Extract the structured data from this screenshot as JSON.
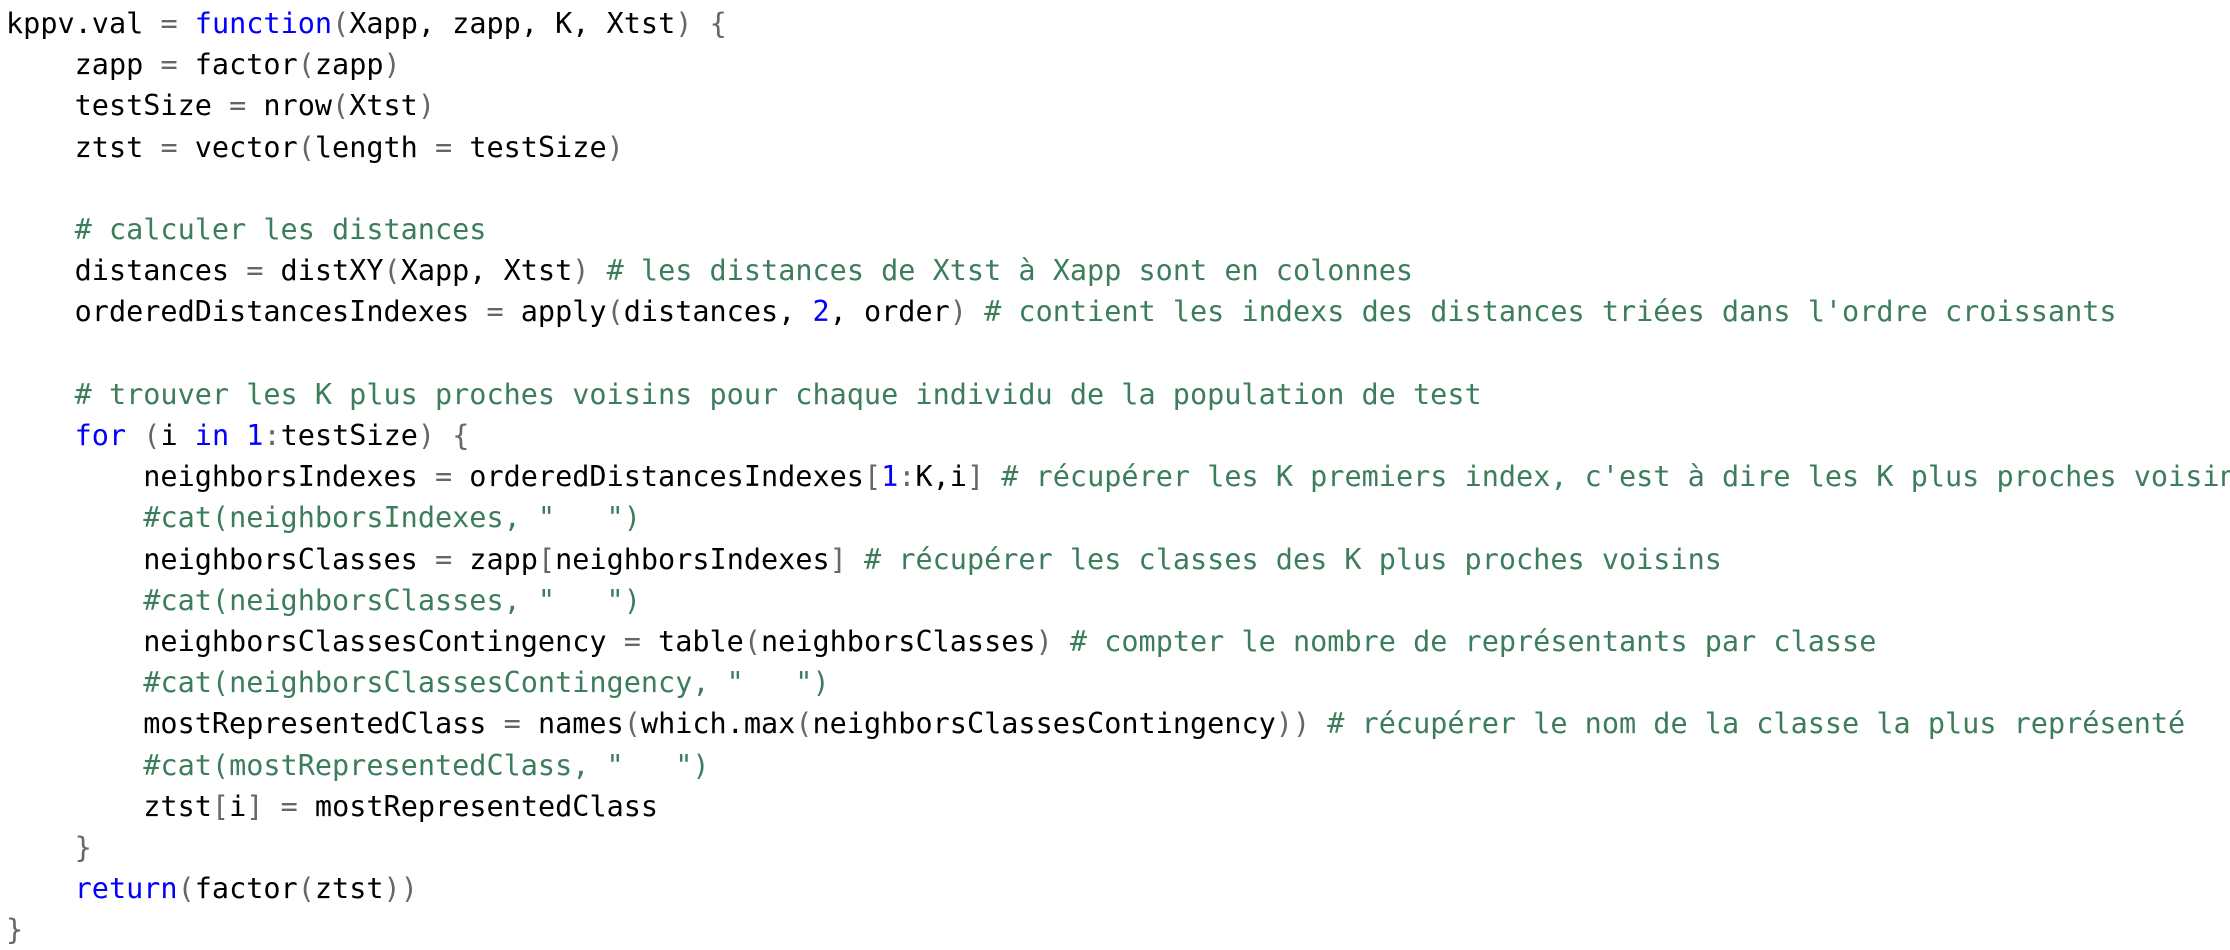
{
  "editor": {
    "language": "R",
    "colors": {
      "plain": "#000000",
      "keyword": "#0000ff",
      "number": "#0000ff",
      "comment": "#3c7d5b",
      "string": "#3c7d5b",
      "bracket": "#666666",
      "operator": "#666666",
      "background": "#ffffff"
    },
    "lines": [
      [
        [
          "plain",
          "kppv.val "
        ],
        [
          "operator",
          "="
        ],
        [
          "plain",
          " "
        ],
        [
          "keyword",
          "function"
        ],
        [
          "bracket",
          "("
        ],
        [
          "plain",
          "Xapp, zapp, K, Xtst"
        ],
        [
          "bracket",
          ")"
        ],
        [
          "plain",
          " "
        ],
        [
          "bracket",
          "{"
        ]
      ],
      [
        [
          "plain",
          "    zapp "
        ],
        [
          "operator",
          "="
        ],
        [
          "plain",
          " factor"
        ],
        [
          "bracket",
          "("
        ],
        [
          "plain",
          "zapp"
        ],
        [
          "bracket",
          ")"
        ]
      ],
      [
        [
          "plain",
          "    testSize "
        ],
        [
          "operator",
          "="
        ],
        [
          "plain",
          " nrow"
        ],
        [
          "bracket",
          "("
        ],
        [
          "plain",
          "Xtst"
        ],
        [
          "bracket",
          ")"
        ]
      ],
      [
        [
          "plain",
          "    ztst "
        ],
        [
          "operator",
          "="
        ],
        [
          "plain",
          " vector"
        ],
        [
          "bracket",
          "("
        ],
        [
          "plain",
          "length "
        ],
        [
          "operator",
          "="
        ],
        [
          "plain",
          " testSize"
        ],
        [
          "bracket",
          ")"
        ]
      ],
      [],
      [
        [
          "plain",
          "    "
        ],
        [
          "comment",
          "# calculer les distances"
        ]
      ],
      [
        [
          "plain",
          "    distances "
        ],
        [
          "operator",
          "="
        ],
        [
          "plain",
          " distXY"
        ],
        [
          "bracket",
          "("
        ],
        [
          "plain",
          "Xapp, Xtst"
        ],
        [
          "bracket",
          ")"
        ],
        [
          "plain",
          " "
        ],
        [
          "comment",
          "# les distances de Xtst à Xapp sont en colonnes"
        ]
      ],
      [
        [
          "plain",
          "    orderedDistancesIndexes "
        ],
        [
          "operator",
          "="
        ],
        [
          "plain",
          " apply"
        ],
        [
          "bracket",
          "("
        ],
        [
          "plain",
          "distances, "
        ],
        [
          "number",
          "2"
        ],
        [
          "plain",
          ", order"
        ],
        [
          "bracket",
          ")"
        ],
        [
          "plain",
          " "
        ],
        [
          "comment",
          "# contient les indexs des distances triées dans l'ordre croissants"
        ]
      ],
      [],
      [
        [
          "plain",
          "    "
        ],
        [
          "comment",
          "# trouver les K plus proches voisins pour chaque individu de la population de test"
        ]
      ],
      [
        [
          "plain",
          "    "
        ],
        [
          "keyword",
          "for"
        ],
        [
          "plain",
          " "
        ],
        [
          "bracket",
          "("
        ],
        [
          "plain",
          "i "
        ],
        [
          "keyword",
          "in"
        ],
        [
          "plain",
          " "
        ],
        [
          "number",
          "1"
        ],
        [
          "operator",
          ":"
        ],
        [
          "plain",
          "testSize"
        ],
        [
          "bracket",
          ")"
        ],
        [
          "plain",
          " "
        ],
        [
          "bracket",
          "{"
        ]
      ],
      [
        [
          "plain",
          "        neighborsIndexes "
        ],
        [
          "operator",
          "="
        ],
        [
          "plain",
          " orderedDistancesIndexes"
        ],
        [
          "bracket",
          "["
        ],
        [
          "number",
          "1"
        ],
        [
          "operator",
          ":"
        ],
        [
          "plain",
          "K,i"
        ],
        [
          "bracket",
          "]"
        ],
        [
          "plain",
          " "
        ],
        [
          "comment",
          "# récupérer les K premiers index, c'est à dire les K plus proches voisins"
        ]
      ],
      [
        [
          "plain",
          "        "
        ],
        [
          "comment",
          "#cat(neighborsIndexes, \"   \")"
        ]
      ],
      [
        [
          "plain",
          "        neighborsClasses "
        ],
        [
          "operator",
          "="
        ],
        [
          "plain",
          " zapp"
        ],
        [
          "bracket",
          "["
        ],
        [
          "plain",
          "neighborsIndexes"
        ],
        [
          "bracket",
          "]"
        ],
        [
          "plain",
          " "
        ],
        [
          "comment",
          "# récupérer les classes des K plus proches voisins"
        ]
      ],
      [
        [
          "plain",
          "        "
        ],
        [
          "comment",
          "#cat(neighborsClasses, \"   \")"
        ]
      ],
      [
        [
          "plain",
          "        neighborsClassesContingency "
        ],
        [
          "operator",
          "="
        ],
        [
          "plain",
          " table"
        ],
        [
          "bracket",
          "("
        ],
        [
          "plain",
          "neighborsClasses"
        ],
        [
          "bracket",
          ")"
        ],
        [
          "plain",
          " "
        ],
        [
          "comment",
          "# compter le nombre de représentants par classe"
        ]
      ],
      [
        [
          "plain",
          "        "
        ],
        [
          "comment",
          "#cat(neighborsClassesContingency, \"   \")"
        ]
      ],
      [
        [
          "plain",
          "        mostRepresentedClass "
        ],
        [
          "operator",
          "="
        ],
        [
          "plain",
          " names"
        ],
        [
          "bracket",
          "("
        ],
        [
          "plain",
          "which.max"
        ],
        [
          "bracket",
          "("
        ],
        [
          "plain",
          "neighborsClassesContingency"
        ],
        [
          "bracket",
          "))"
        ],
        [
          "plain",
          " "
        ],
        [
          "comment",
          "# récupérer le nom de la classe la plus représenté"
        ]
      ],
      [
        [
          "plain",
          "        "
        ],
        [
          "comment",
          "#cat(mostRepresentedClass, \"   \")"
        ]
      ],
      [
        [
          "plain",
          "        ztst"
        ],
        [
          "bracket",
          "["
        ],
        [
          "plain",
          "i"
        ],
        [
          "bracket",
          "]"
        ],
        [
          "plain",
          " "
        ],
        [
          "operator",
          "="
        ],
        [
          "plain",
          " mostRepresentedClass"
        ]
      ],
      [
        [
          "plain",
          "    "
        ],
        [
          "bracket",
          "}"
        ]
      ],
      [
        [
          "plain",
          "    "
        ],
        [
          "keyword",
          "return"
        ],
        [
          "bracket",
          "("
        ],
        [
          "plain",
          "factor"
        ],
        [
          "bracket",
          "("
        ],
        [
          "plain",
          "ztst"
        ],
        [
          "bracket",
          "))"
        ]
      ],
      [
        [
          "bracket",
          "}"
        ]
      ]
    ]
  }
}
